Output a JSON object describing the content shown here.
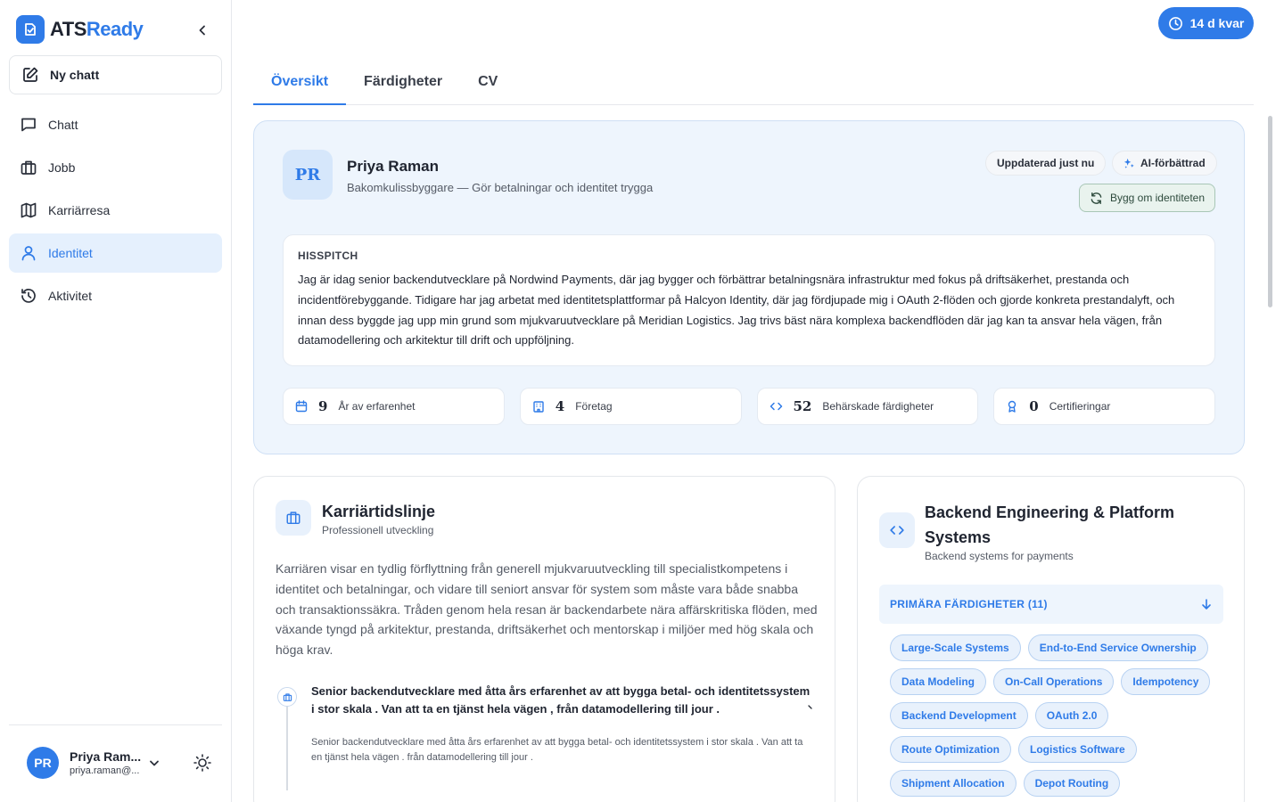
{
  "app": {
    "logo_prefix": "ATS",
    "logo_accent": "Ready",
    "accent_color": "#2f7be8"
  },
  "sidebar": {
    "new_chat_label": "Ny chatt",
    "items": [
      {
        "label": "Chatt",
        "icon": "chat-icon",
        "active": false
      },
      {
        "label": "Jobb",
        "icon": "briefcase-icon",
        "active": false
      },
      {
        "label": "Karriärresa",
        "icon": "map-icon",
        "active": false
      },
      {
        "label": "Identitet",
        "icon": "user-icon",
        "active": true
      },
      {
        "label": "Aktivitet",
        "icon": "history-icon",
        "active": false
      }
    ],
    "user": {
      "initials": "PR",
      "name": "Priya Ram...",
      "email": "priya.raman@..."
    }
  },
  "header": {
    "trial_label": "14 d kvar"
  },
  "tabs": [
    {
      "label": "Översikt",
      "active": true
    },
    {
      "label": "Färdigheter",
      "active": false
    },
    {
      "label": "CV",
      "active": false
    }
  ],
  "profile": {
    "initials": "PR",
    "name": "Priya Raman",
    "tagline": "Bakomkulissbyggare — Gör betalningar och identitet trygga",
    "updated_label": "Uppdaterad just nu",
    "ai_label": "AI-förbättrad",
    "rebuild_label": "Bygg om identiteten",
    "pitch_title": "HISSPITCH",
    "pitch_text": "Jag är idag senior backendutvecklare på Nordwind Payments, där jag bygger och förbättrar betalningsnära infrastruktur med fokus på driftsäkerhet, prestanda och incidentförebyggande. Tidigare har jag arbetat med identitetsplattformar på Halcyon Identity, där jag fördjupade mig i OAuth 2-flöden och gjorde konkreta prestandalyft, och innan dess byggde jag upp min grund som mjukvaruutvecklare på Meridian Logistics. Jag trivs bäst nära komplexa backendflöden där jag kan ta ansvar hela vägen, från datamodellering och arkitektur till drift och uppföljning.",
    "stats": [
      {
        "value": "9",
        "label": "År av erfarenhet",
        "icon": "calendar-icon"
      },
      {
        "value": "4",
        "label": "Företag",
        "icon": "building-icon"
      },
      {
        "value": "52",
        "label": "Behärskade färdigheter",
        "icon": "code-icon"
      },
      {
        "value": "0",
        "label": "Certifieringar",
        "icon": "award-icon"
      }
    ]
  },
  "timeline": {
    "title": "Karriärtidslinje",
    "subtitle": "Professionell utveckling",
    "summary": "Karriären visar en tydlig förflyttning från generell mjukvaruutveckling till specialistkompetens i identitet och betalningar, och vidare till seniort ansvar för system som måste vara både snabba och transaktionssäkra. Tråden genom hela resan är backendarbete nära affärskritiska flöden, med växande tyngd på arkitektur, prestanda, driftsäkerhet och mentorskap i miljöer med hög skala och höga krav.",
    "entry": {
      "title": "Senior backendutvecklare med åtta års erfarenhet av att bygga betal- och identitetssystem i stor skala . Van att ta en tjänst hela vägen , från datamodellering till jour .",
      "description": "Senior backendutvecklare med åtta års erfarenhet av att bygga betal- och identitetssystem i stor skala . Van att ta en tjänst hela vägen . från datamodellering till jour ."
    }
  },
  "skills": {
    "title": "Backend Engineering & Platform Systems",
    "subtitle": "Backend systems for payments",
    "section_label": "PRIMÄRA FÄRDIGHETER (11)",
    "chips": [
      "Large-Scale Systems",
      "End-to-End Service Ownership",
      "Data Modeling",
      "On-Call Operations",
      "Idempotency",
      "Backend Development",
      "OAuth 2.0",
      "Route Optimization",
      "Logistics Software",
      "Shipment Allocation",
      "Depot Routing"
    ]
  }
}
